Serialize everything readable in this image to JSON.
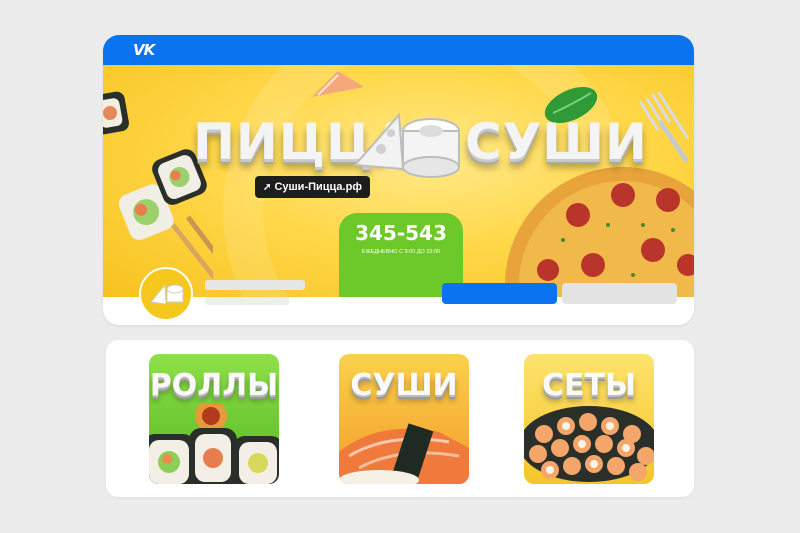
{
  "header": {
    "logo_icon": "vk-logo-icon",
    "logo_text": "VK",
    "bar_color": "#0a73f0"
  },
  "banner": {
    "title_left": "ПИЦЦА",
    "title_right": "СУШИ",
    "website": "Суши-Пицца.рф",
    "phone": "345-543",
    "hours": "ЕЖЕДНЕВНО С 9:00 ДО 22:00",
    "background_color": "#ffd84a",
    "accent_color": "#6dc82a"
  },
  "profile": {
    "avatar_icon": "pizza-sushi-logo-icon",
    "primary_button_color": "#0a73f0",
    "secondary_button_color": "#e3e3e3"
  },
  "categories": [
    {
      "label": "РОЛЛЫ",
      "color": "#6fd126"
    },
    {
      "label": "СУШИ",
      "color": "#f7a934"
    },
    {
      "label": "СЕТЫ",
      "color": "#f6d13a"
    }
  ]
}
